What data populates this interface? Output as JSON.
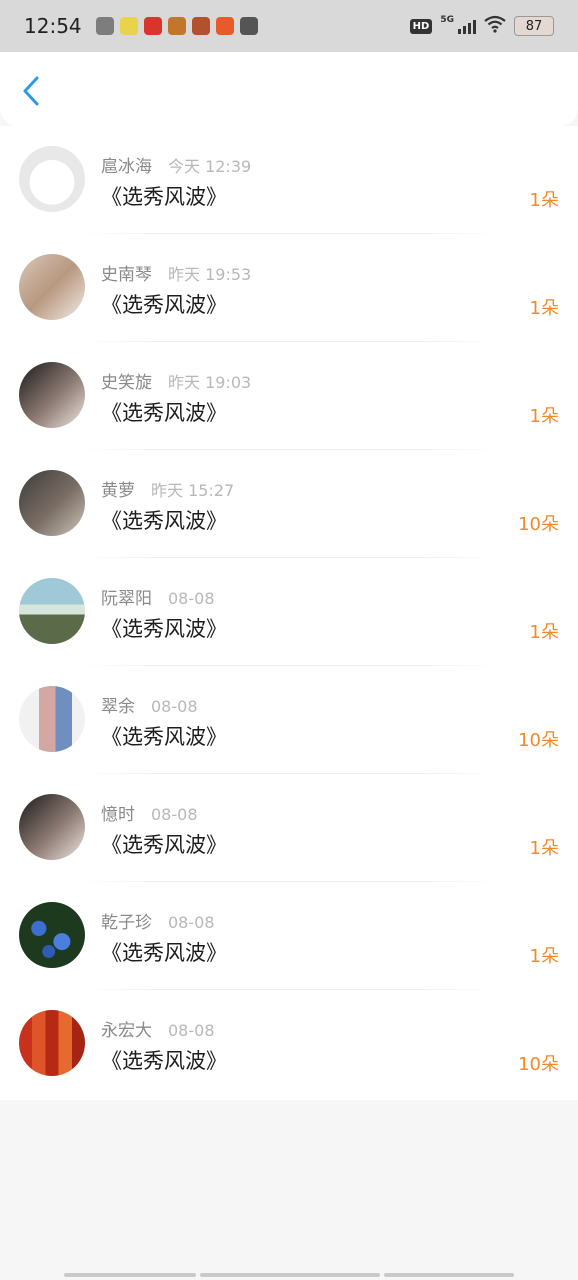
{
  "status_bar": {
    "time": "12:54",
    "network": "5G",
    "hd": "HD",
    "battery": "87",
    "app_icons": [
      {
        "name": "settings-app-icon",
        "color": "#7d7d7d"
      },
      {
        "name": "face-app-icon",
        "color": "#e9d34a"
      },
      {
        "name": "red-app-icon",
        "color": "#d8362d"
      },
      {
        "name": "game-app-icon",
        "color": "#c2762c"
      },
      {
        "name": "game2-app-icon",
        "color": "#b3502d"
      },
      {
        "name": "orange-app-icon",
        "color": "#e85a2a"
      },
      {
        "name": "crown-app-icon",
        "color": "#555555"
      }
    ]
  },
  "header": {
    "back_icon": "chevron-left-icon",
    "accent": "#2b9be8"
  },
  "gifts": [
    {
      "name": "扈冰海",
      "time": "今天 12:39",
      "title": "《选秀风波》",
      "count": "1朵",
      "avatar": "cartoon-face"
    },
    {
      "name": "史南琴",
      "time": "昨天 19:53",
      "title": "《选秀风波》",
      "count": "1朵",
      "avatar": "portrait"
    },
    {
      "name": "史笑旋",
      "time": "昨天 19:03",
      "title": "《选秀风波》",
      "count": "1朵",
      "avatar": "portrait"
    },
    {
      "name": "黄萝",
      "time": "昨天 15:27",
      "title": "《选秀风波》",
      "count": "10朵",
      "avatar": "portrait"
    },
    {
      "name": "阮翠阳",
      "time": "08-08",
      "title": "《选秀风波》",
      "count": "1朵",
      "avatar": "landscape"
    },
    {
      "name": "翠余",
      "time": "08-08",
      "title": "《选秀风波》",
      "count": "10朵",
      "avatar": "couple"
    },
    {
      "name": "憶时",
      "time": "08-08",
      "title": "《选秀风波》",
      "count": "1朵",
      "avatar": "portrait"
    },
    {
      "name": "乾子珍",
      "time": "08-08",
      "title": "《选秀风波》",
      "count": "1朵",
      "avatar": "flowers"
    },
    {
      "name": "永宏大",
      "time": "08-08",
      "title": "《选秀风波》",
      "count": "10朵",
      "avatar": "autumn-trees"
    }
  ],
  "colors": {
    "count": "#f08a2c",
    "name": "#8a8a8a",
    "time": "#b8b8b8",
    "title": "#1d1d1d"
  }
}
